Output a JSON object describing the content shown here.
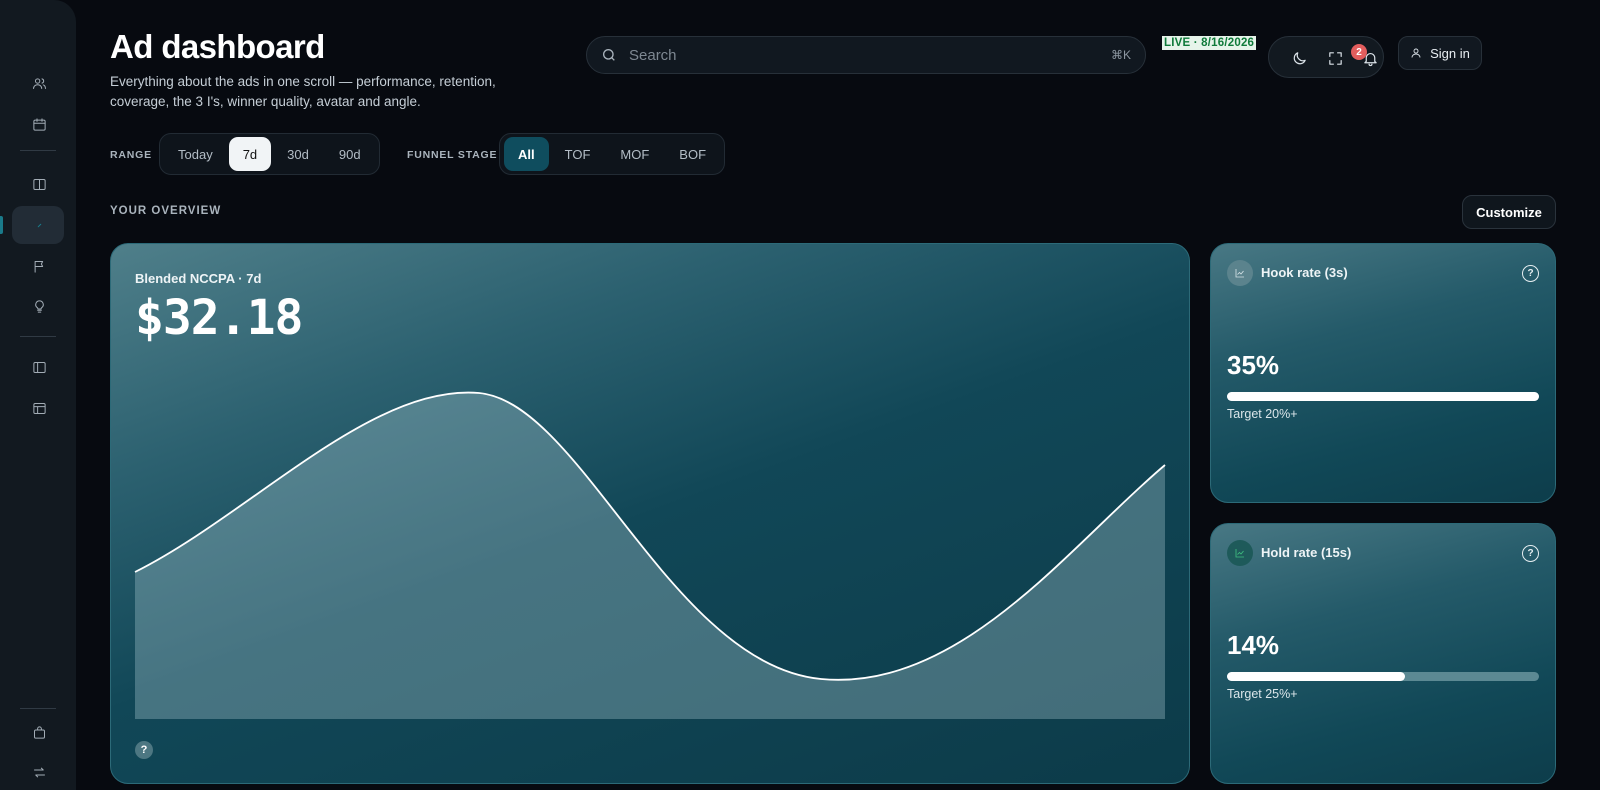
{
  "header": {
    "title": "Ad dashboard",
    "subtitle": "Everything about the ads in one scroll — performance, retention, coverage, the 3 I's, winner quality, avatar and angle."
  },
  "search": {
    "placeholder": "Search",
    "shortcut": "⌘K"
  },
  "live_badge": "LIVE · 8/16/2026",
  "notifications": {
    "count": "2"
  },
  "signin_label": "Sign in",
  "filters": {
    "range_label": "RANGE",
    "range_options": [
      "Today",
      "7d",
      "30d",
      "90d"
    ],
    "range_selected": "7d",
    "funnel_label": "FUNNEL STAGE",
    "funnel_options": [
      "All",
      "TOF",
      "MOF",
      "BOF"
    ],
    "funnel_selected": "All"
  },
  "overview": {
    "label": "YOUR OVERVIEW",
    "customize_label": "Customize"
  },
  "main_card": {
    "label": "Blended NCCPA · 7d",
    "value": "$32.18",
    "help": "?"
  },
  "side_cards": [
    {
      "title": "Hook rate (3s)",
      "value": "35%",
      "progress": 1.0,
      "target": "Target 20%+",
      "help": "?"
    },
    {
      "title": "Hold rate (15s)",
      "value": "14%",
      "progress": 0.57,
      "target": "Target 25%+",
      "help": "?"
    }
  ],
  "colors": {
    "background": "#070a10",
    "sidebar": "#121920",
    "card_teal": "#114757",
    "accent_selected": "#0f4d5e",
    "badge_red": "#e35d5d",
    "live_green": "#0f7a3a"
  },
  "sidebar_icons": [
    "users-icon",
    "calendar-icon",
    "book-icon",
    "trend-icon",
    "flag-icon",
    "lightbulb-icon",
    "panel-icon",
    "layout-icon",
    "bag-icon",
    "swap-icon"
  ]
}
